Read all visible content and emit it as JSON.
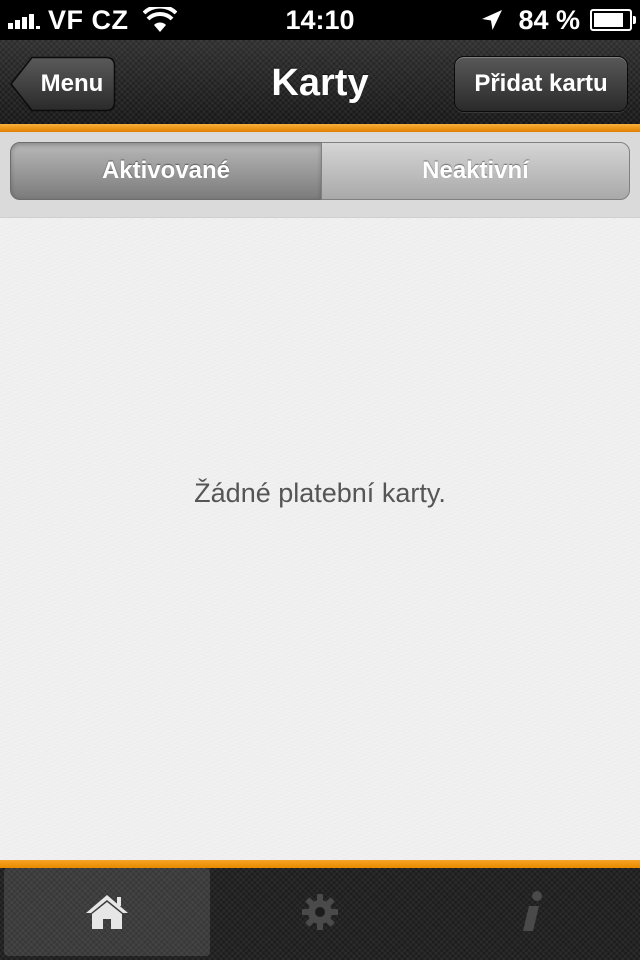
{
  "status_bar": {
    "carrier": "VF CZ",
    "time": "14:10",
    "battery_percent": "84 %",
    "battery_level": 0.84
  },
  "nav_bar": {
    "title": "Karty",
    "back_label": "Menu",
    "action_label": "Přidat kartu"
  },
  "segments": {
    "active_label": "Aktivované",
    "inactive_label": "Neaktivní",
    "selected": "Aktivované"
  },
  "content": {
    "empty_message": "Žádné platební karty."
  },
  "tab_bar": {
    "items": [
      {
        "icon": "home-icon",
        "selected": true
      },
      {
        "icon": "gear-icon",
        "selected": false
      },
      {
        "icon": "info-icon",
        "selected": false
      }
    ]
  },
  "colors": {
    "accent": "#f39c12",
    "nav_background": "#1e1e1e",
    "content_background": "#f1f1f1"
  }
}
